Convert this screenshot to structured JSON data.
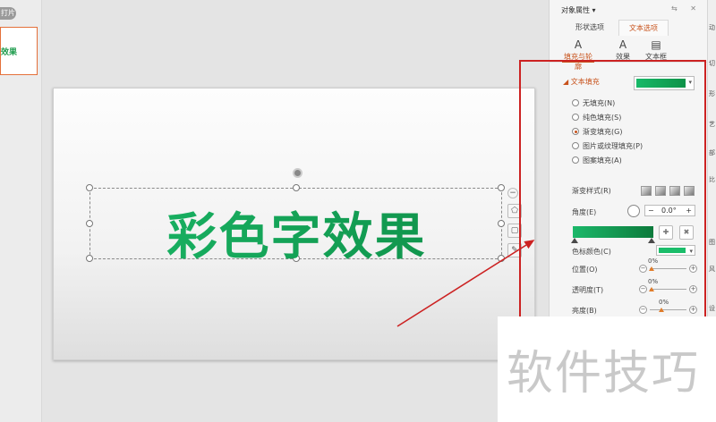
{
  "thumbnails": {
    "tag": "打片",
    "slide_text": "效果"
  },
  "slide": {
    "main_text": "彩色字效果"
  },
  "panel": {
    "title": "对象属性 ▾",
    "title_icons": "⇆ ✕",
    "tabs": [
      "形状选项",
      "文本选项"
    ],
    "subtabs": [
      {
        "icon": "A",
        "label": "填充与轮廓"
      },
      {
        "icon": "A",
        "label": "效果"
      },
      {
        "icon": "▤",
        "label": "文本框"
      }
    ],
    "fill_section": "◢ 文本填充",
    "fill_options": [
      {
        "label": "无填充(N)",
        "selected": false
      },
      {
        "label": "纯色填充(S)",
        "selected": false
      },
      {
        "label": "渐变填充(G)",
        "selected": true
      },
      {
        "label": "图片或纹理填充(P)",
        "selected": false
      },
      {
        "label": "图案填充(A)",
        "selected": false
      }
    ],
    "gradient_style_label": "渐变样式(R)",
    "angle_label": "角度(E)",
    "angle_value": "0.0°",
    "minus": "−",
    "plus": "+",
    "stop_color_label": "色标颜色(C)",
    "position_label": "位置(O)",
    "position_value": "0%",
    "transparency_label": "透明度(T)",
    "transparency_value": "0%",
    "brightness_label": "亮度(B)",
    "brightness_value": "0%"
  },
  "side_strip": [
    "动",
    "切",
    "形",
    "艺",
    "部",
    "比",
    "图",
    "风",
    "设"
  ],
  "watermark": "软件技巧",
  "colors": {
    "accent": "#c8531c",
    "gradient_start": "#1cb86a",
    "gradient_end": "#0c7a3b",
    "annotation": "#cc2222"
  }
}
